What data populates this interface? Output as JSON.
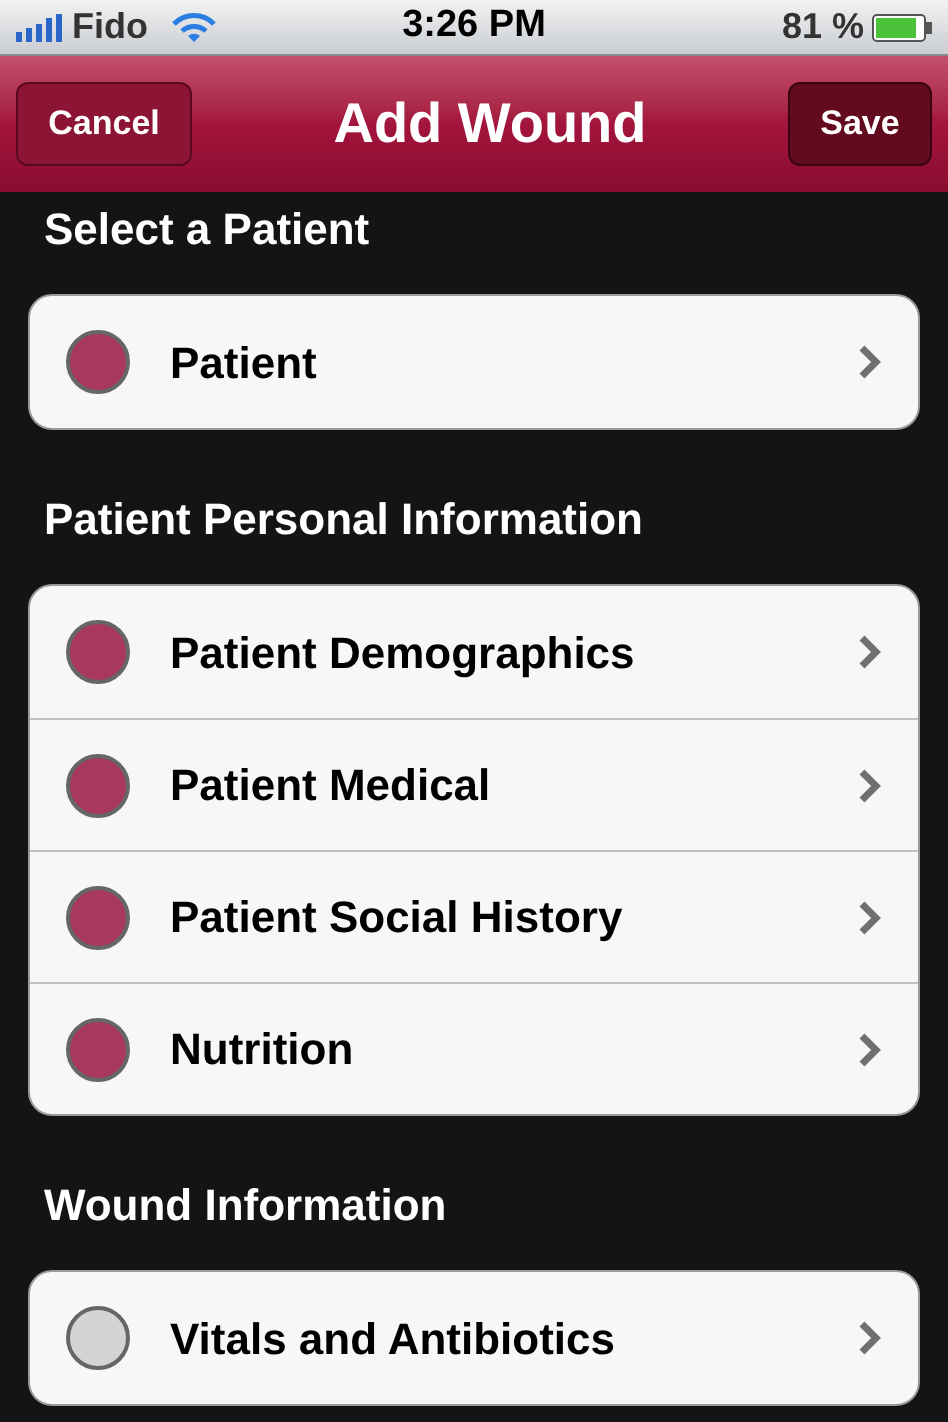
{
  "status_bar": {
    "carrier": "Fido",
    "time": "3:26 PM",
    "battery": "81 %"
  },
  "nav_bar": {
    "title": "Add Wound",
    "left_button": "Cancel",
    "right_button": "Save"
  },
  "sections": [
    {
      "header": "Select a Patient",
      "items": [
        {
          "label": "Patient",
          "color": "#a8385e"
        }
      ]
    },
    {
      "header": "Patient Personal Information",
      "items": [
        {
          "label": "Patient Demographics",
          "color": "#a8385e"
        },
        {
          "label": "Patient Medical",
          "color": "#a8385e"
        },
        {
          "label": "Patient Social History",
          "color": "#a8385e"
        },
        {
          "label": "Nutrition",
          "color": "#a8385e"
        }
      ]
    },
    {
      "header": "Wound Information",
      "items": [
        {
          "label": "Vitals and Antibiotics",
          "color": "#d4d4d4"
        }
      ]
    }
  ]
}
